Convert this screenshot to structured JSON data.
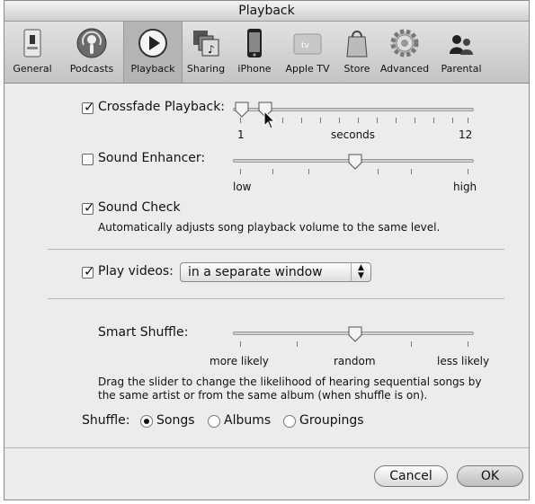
{
  "window": {
    "title": "Playback"
  },
  "toolbar": [
    {
      "label": "General",
      "icon": "general-switch-icon"
    },
    {
      "label": "Podcasts",
      "icon": "podcast-icon"
    },
    {
      "label": "Playback",
      "icon": "play-icon",
      "selected": true
    },
    {
      "label": "Sharing",
      "icon": "sharing-icon"
    },
    {
      "label": "iPhone",
      "icon": "iphone-icon"
    },
    {
      "label": "Apple TV",
      "icon": "apple-tv-icon"
    },
    {
      "label": "Store",
      "icon": "store-bag-icon"
    },
    {
      "label": "Advanced",
      "icon": "gear-icon"
    },
    {
      "label": "Parental",
      "icon": "parental-people-icon"
    }
  ],
  "crossfade": {
    "label": "Crossfade Playback:",
    "checked": true,
    "value_seconds": 2,
    "min_label": "1",
    "mid_label": "seconds",
    "max_label": "12"
  },
  "sound_enhancer": {
    "label": "Sound Enhancer:",
    "checked": false,
    "level": 0.5,
    "low_label": "low",
    "high_label": "high"
  },
  "sound_check": {
    "label": "Sound Check",
    "checked": true,
    "description": "Automatically adjusts song playback volume to the same level."
  },
  "play_videos": {
    "label": "Play videos:",
    "checked": true,
    "selected": "in a separate window"
  },
  "smart_shuffle": {
    "label": "Smart Shuffle:",
    "level": 0.5,
    "left_label": "more likely",
    "mid_label": "random",
    "right_label": "less likely",
    "description_1": "Drag the slider to change the likelihood of hearing sequential songs by",
    "description_2": "the same artist or from the same album (when shuffle is on)."
  },
  "shuffle": {
    "label": "Shuffle:",
    "options": [
      "Songs",
      "Albums",
      "Groupings"
    ],
    "selected": "Songs"
  },
  "buttons": {
    "cancel": "Cancel",
    "ok": "OK"
  }
}
